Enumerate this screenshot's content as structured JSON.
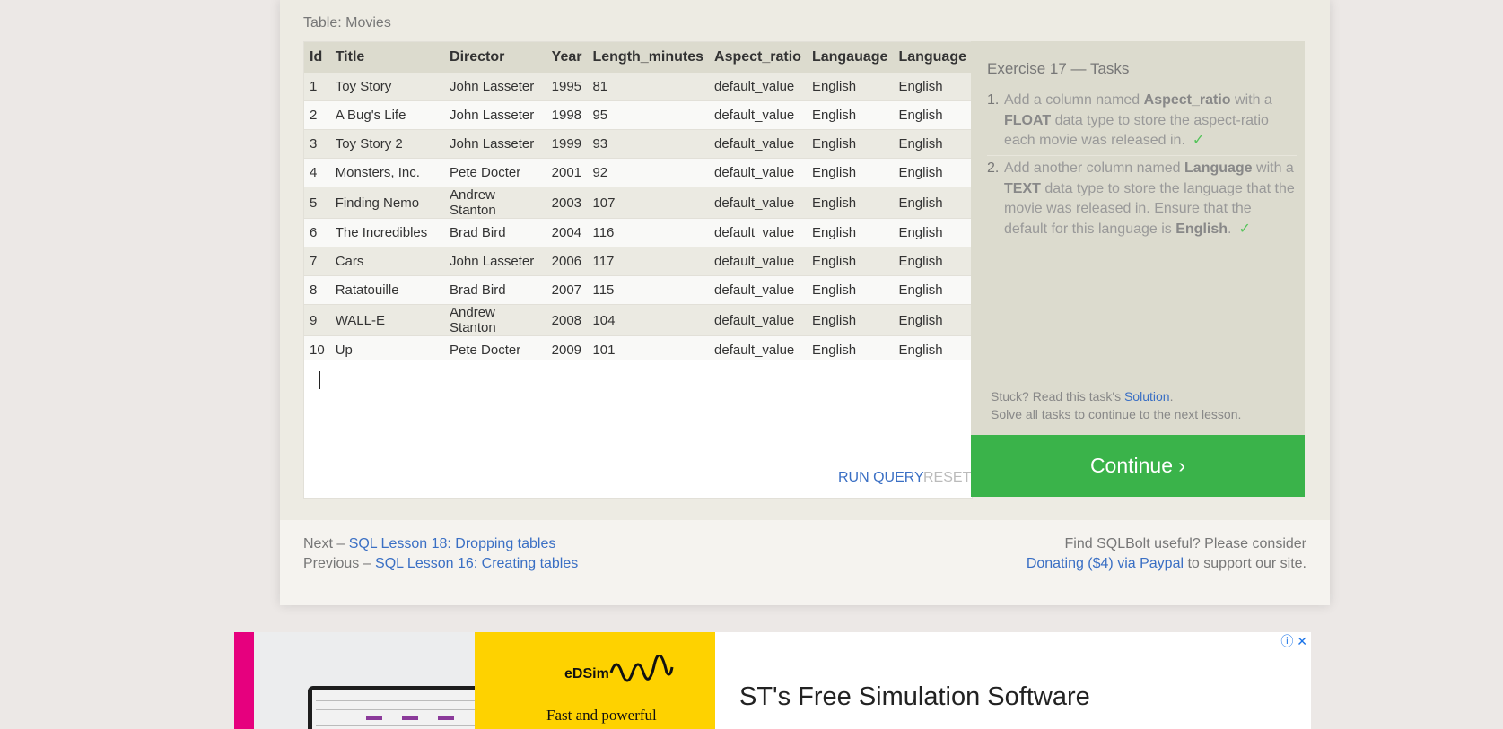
{
  "table_caption": "Table: Movies",
  "table": {
    "headers": [
      "Id",
      "Title",
      "Director",
      "Year",
      "Length_minutes",
      "Aspect_ratio",
      "Langauage",
      "Language"
    ],
    "rows": [
      [
        "1",
        "Toy Story",
        "John Lasseter",
        "1995",
        "81",
        "default_value",
        "English",
        "English"
      ],
      [
        "2",
        "A Bug's Life",
        "John Lasseter",
        "1998",
        "95",
        "default_value",
        "English",
        "English"
      ],
      [
        "3",
        "Toy Story 2",
        "John Lasseter",
        "1999",
        "93",
        "default_value",
        "English",
        "English"
      ],
      [
        "4",
        "Monsters, Inc.",
        "Pete Docter",
        "2001",
        "92",
        "default_value",
        "English",
        "English"
      ],
      [
        "5",
        "Finding Nemo",
        "Andrew Stanton",
        "2003",
        "107",
        "default_value",
        "English",
        "English"
      ],
      [
        "6",
        "The Incredibles",
        "Brad Bird",
        "2004",
        "116",
        "default_value",
        "English",
        "English"
      ],
      [
        "7",
        "Cars",
        "John Lasseter",
        "2006",
        "117",
        "default_value",
        "English",
        "English"
      ],
      [
        "8",
        "Ratatouille",
        "Brad Bird",
        "2007",
        "115",
        "default_value",
        "English",
        "English"
      ],
      [
        "9",
        "WALL-E",
        "Andrew Stanton",
        "2008",
        "104",
        "default_value",
        "English",
        "English"
      ],
      [
        "10",
        "Up",
        "Pete Docter",
        "2009",
        "101",
        "default_value",
        "English",
        "English"
      ]
    ]
  },
  "editor": {
    "value": "",
    "run_label": "RUN QUERY",
    "reset_label": "RESET"
  },
  "tasks": {
    "title": "Exercise 17 — Tasks",
    "items": [
      {
        "num": "1.",
        "p1": "Add a column named ",
        "b1": "Aspect_ratio",
        "p2": " with a ",
        "b2": "FLOAT",
        "p3": " data type to store the aspect-ratio each movie was released in.",
        "check": "✓"
      },
      {
        "num": "2.",
        "p1": "Add another column named ",
        "b1": "Language",
        "p2": " with a ",
        "b2": "TEXT",
        "p3": " data type to store the language that the movie was released in. Ensure that the default for this language is ",
        "b3": "English",
        "p4": ".",
        "check": "✓"
      }
    ],
    "stuck_prefix": "Stuck? Read this task's ",
    "solution_link": "Solution",
    "stuck_suffix": ".",
    "solve_all": "Solve all tasks to continue to the next lesson.",
    "continue_label": "Continue ›"
  },
  "nav": {
    "next_prefix": "Next – ",
    "next_link": "SQL Lesson 18: Dropping tables",
    "prev_prefix": "Previous – ",
    "prev_link": "SQL Lesson 16: Creating tables"
  },
  "support": {
    "line1": "Find SQLBolt useful? Please consider",
    "donate_link": "Donating ($4) via Paypal",
    "line2_suffix": " to support our site."
  },
  "ad": {
    "brand": "eDSim",
    "tagline": "Fast and powerful",
    "headline": "ST's Free Simulation Software",
    "info_icon": "ⓘ",
    "close_icon": "✕"
  },
  "colors": {
    "accent_link": "#3a6fc4",
    "continue_green": "#3ab34a",
    "check_green": "#55c45a",
    "ad_yellow": "#fed200",
    "ad_pink": "#e6007e"
  }
}
